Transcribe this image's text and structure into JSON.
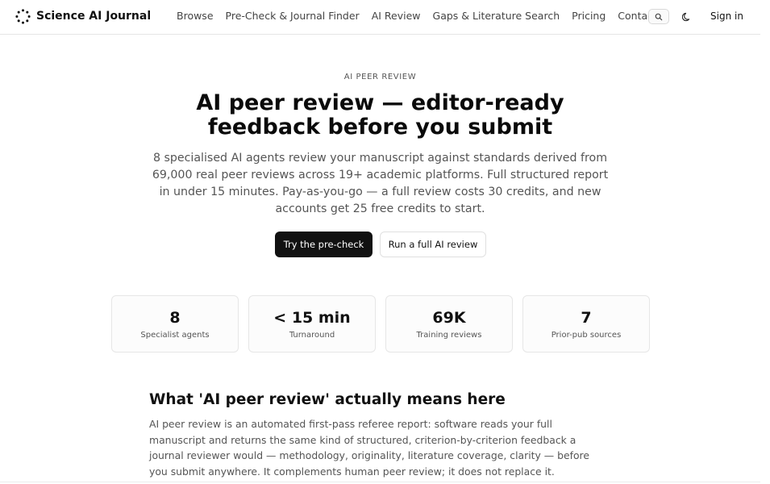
{
  "header": {
    "brand": "Science AI Journal",
    "logo_icon": "dotted-circle-logo-icon",
    "nav": [
      "Browse",
      "Pre-Check & Journal Finder",
      "AI Review",
      "Gaps & Literature Search",
      "Pricing",
      "Contact"
    ],
    "search_icon": "search-icon",
    "theme_icon": "moon-icon",
    "signin": "Sign in"
  },
  "hero": {
    "eyebrow": "AI PEER REVIEW",
    "title": "AI peer review — editor-ready feedback before you submit",
    "lead": "8 specialised AI agents review your manuscript against standards derived from 69,000 real peer reviews across 19+ academic platforms. Full structured report in under 15 minutes. Pay-as-you-go — a full review costs 30 credits, and new accounts get 25 free credits to start.",
    "primary_cta": "Try the pre-check",
    "secondary_cta": "Run a full AI review"
  },
  "stats": [
    {
      "value": "8",
      "label": "Specialist agents"
    },
    {
      "value": "< 15 min",
      "label": "Turnaround"
    },
    {
      "value": "69K",
      "label": "Training reviews"
    },
    {
      "value": "7",
      "label": "Prior-pub sources"
    }
  ],
  "section": {
    "title": "What 'AI peer review' actually means here",
    "body": "AI peer review is an automated first-pass referee report: software reads your full manuscript and returns the same kind of structured, criterion-by-criterion feedback a journal reviewer would — methodology, originality, literature coverage, clarity — before you submit anywhere. It complements human peer review; it does not replace it."
  },
  "colors": {
    "primary_button": "#111111",
    "text_muted": "#555555",
    "border": "#e5e5e5"
  }
}
